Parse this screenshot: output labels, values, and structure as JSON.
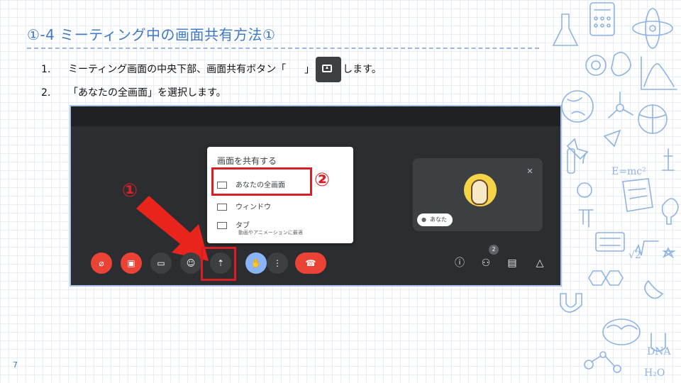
{
  "slide": {
    "title": "①-4 ミーティング中の画面共有方法①",
    "page_number": "7"
  },
  "steps": [
    {
      "num": "1.",
      "text_before": "ミーティング画面の中央下部、画面共有ボタン「",
      "text_middle": "」",
      "text_after": "します。"
    },
    {
      "num": "2.",
      "text": "「あなたの全画面」を選択します。"
    }
  ],
  "screenshot": {
    "popup_title": "画面を共有する",
    "options": [
      {
        "label": "あなたの全画面",
        "icon": "laptop-icon"
      },
      {
        "label": "ウィンドウ",
        "icon": "window-icon"
      },
      {
        "label": "タブ",
        "sub": "動画やアニメーションに最適",
        "icon": "tab-icon"
      }
    ],
    "participant_name": "あなた",
    "participant_count": "2",
    "callout_1": "①",
    "callout_2": "②",
    "colors": {
      "accent": "#3f79c6",
      "highlight": "#d81f26",
      "call_end": "#ea4335",
      "hand": "#8ab4f8"
    }
  }
}
